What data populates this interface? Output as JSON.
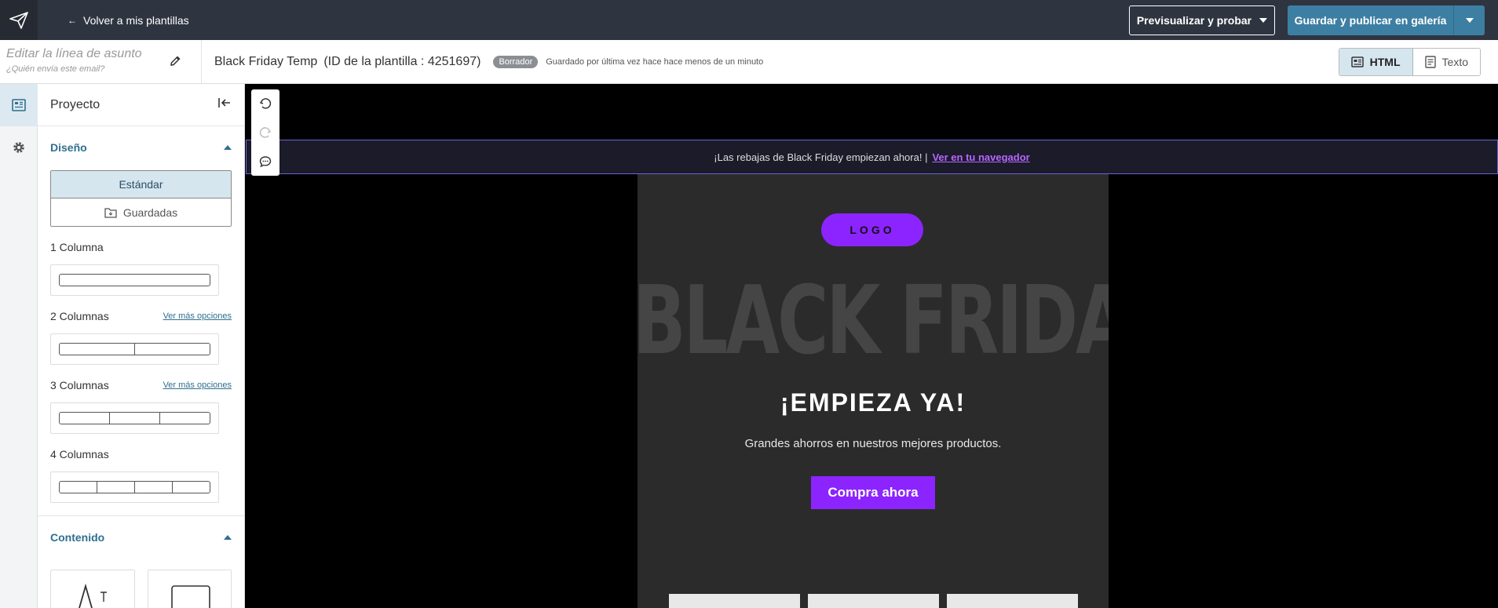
{
  "topbar": {
    "back_label": "Volver a mis plantillas",
    "back_arrow": "←",
    "preview_label": "Previsualizar y probar",
    "publish_label": "Guardar y publicar en galería"
  },
  "subbar": {
    "subject_placeholder": "Editar la línea de asunto",
    "sender_placeholder": "¿Quién envía este email?",
    "template_name": "Black Friday Temp",
    "template_id": "(ID de la plantilla : 4251697)",
    "status_badge": "Borrador",
    "saved_status": "Guardado por última vez hace hace menos de un minuto",
    "mode_html": "HTML",
    "mode_text": "Texto"
  },
  "panel": {
    "title": "Proyecto",
    "design_section": "Diseño",
    "standard_label": "Estándar",
    "saved_label": "Guardadas",
    "col1": "1 Columna",
    "col2": "2 Columnas",
    "col3": "3 Columnas",
    "col4": "4 Columnas",
    "more_options": "Ver más opciones",
    "content_section": "Contenido"
  },
  "email": {
    "preheader_text": "¡Las rebajas de Black Friday empiezan ahora! |",
    "preheader_link": "Ver en tu navegador",
    "logo": "LOGO",
    "big_title": "BLACK FRIDAY",
    "headline": "¡EMPIEZA YA!",
    "subheadline": "Grandes ahorros en nuestros mejores productos.",
    "cta": "Compra ahora"
  },
  "colors": {
    "topbar": "#2f3540",
    "accent_blue": "#3d7fa3",
    "email_purple": "#8c24ff",
    "email_bg": "#2b2b2b"
  }
}
